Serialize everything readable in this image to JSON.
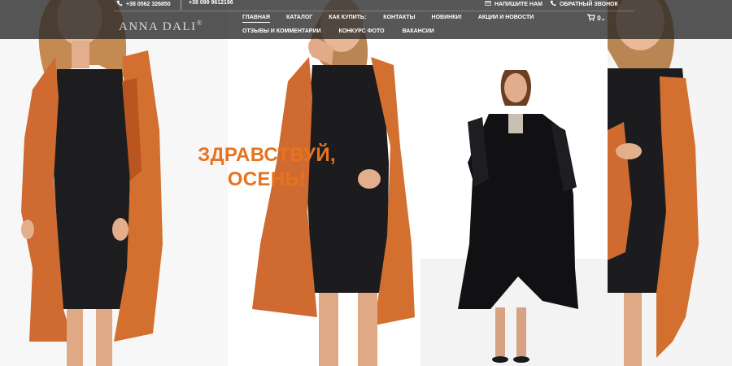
{
  "header": {
    "phone1": "+38 0562 326850",
    "phone2": "+38 099 9612196",
    "write_us": "НАПИШИТЕ НАМ",
    "callback": "ОБРАТНЫЙ ЗВОНОК",
    "logo": "ANNA DALI",
    "logo_mark": "®",
    "cart_count": "0"
  },
  "nav": {
    "row1": [
      "ГЛАВНАЯ",
      "КАТАЛОГ",
      "КАК КУПИТЬ:",
      "КОНТАКТЫ",
      "НОВИНКИ!",
      "АКЦИИ И НОВОСТИ"
    ],
    "row2": [
      "ОТЗЫВЫ И КОММЕНТАРИИ",
      "КОНКУРС ФОТО",
      "ВАКАНСИИ"
    ],
    "active_index": 0
  },
  "hero": {
    "line1": "ЗДРАВСТВУЙ,",
    "line2": "ОСЕНЬ!",
    "accent_color": "#e8731e"
  },
  "colors": {
    "coat_orange": "#d1682e",
    "dress_black": "#1c1c1f",
    "header_bg": "#282828"
  }
}
